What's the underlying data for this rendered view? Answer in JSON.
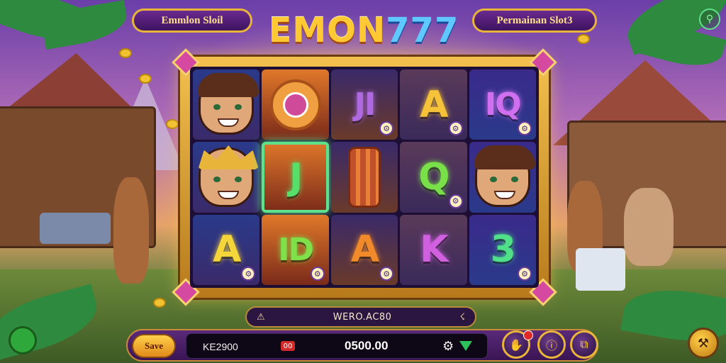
{
  "header": {
    "left_plaque": "Emmlon Sloil",
    "logo_part1": "EMON",
    "logo_part2": "777",
    "right_plaque": "Permainan Slot3"
  },
  "reels": [
    [
      {
        "type": "face",
        "name": "hero-portrait",
        "label": ""
      },
      {
        "type": "face-crown",
        "name": "king-portrait",
        "label": ""
      },
      {
        "type": "letter",
        "name": "symbol-a",
        "label": "A",
        "color": "#f5d63a",
        "badge": "⚙"
      }
    ],
    [
      {
        "type": "fox",
        "name": "fox-emblem",
        "label": ""
      },
      {
        "type": "letter",
        "name": "symbol-j-highlight",
        "label": "J",
        "color": "#56e06a",
        "badge": ""
      },
      {
        "type": "letter",
        "name": "symbol-id",
        "label": "ID",
        "color": "#7fe04a",
        "badge": "⚙"
      }
    ],
    [
      {
        "type": "letter",
        "name": "symbol-ji",
        "label": "JI",
        "color": "#b06ae0",
        "badge": "⚙"
      },
      {
        "type": "lantern",
        "name": "lantern-symbol",
        "label": ""
      },
      {
        "type": "letter",
        "name": "symbol-a",
        "label": "A",
        "color": "#f08a2a",
        "badge": "⚙"
      }
    ],
    [
      {
        "type": "letter",
        "name": "symbol-a",
        "label": "A",
        "color": "#f5c23a",
        "badge": "⚙"
      },
      {
        "type": "letter",
        "name": "symbol-q",
        "label": "Q",
        "color": "#7ae04a",
        "badge": "⚙"
      },
      {
        "type": "letter",
        "name": "symbol-k",
        "label": "K",
        "color": "#d060e0",
        "badge": ""
      }
    ],
    [
      {
        "type": "letter",
        "name": "symbol-iq",
        "label": "IQ",
        "color": "#d070f0",
        "badge": "⚙"
      },
      {
        "type": "face",
        "name": "warrior-portrait",
        "label": ""
      },
      {
        "type": "letter",
        "name": "symbol-3",
        "label": "3",
        "color": "#50e08a",
        "badge": "⚙"
      }
    ]
  ],
  "message_bar": {
    "left_icon": "⚠",
    "text": "WERO.AC80",
    "right_icon": "☇"
  },
  "controls": {
    "save_label": "Save",
    "credit_label": "KE2900",
    "bet_icon_label": "00",
    "win_value": "0500.00",
    "gear_icon": "⚙",
    "auto_icon": "✋",
    "info_icon": "ⓘ",
    "paytable_icon": "⧉",
    "settings_icon": "⚒",
    "top_right_icon": "⚲"
  },
  "colors": {
    "accent_gold": "#e8b53a",
    "panel_purple": "#3a1454",
    "win_green": "#2ec25a"
  }
}
